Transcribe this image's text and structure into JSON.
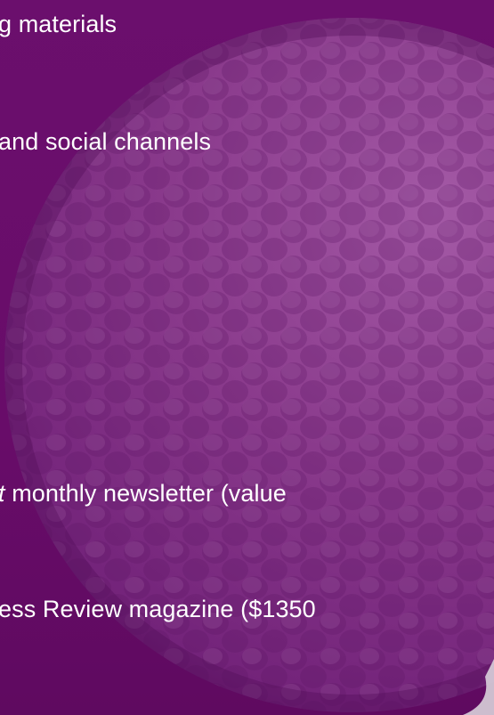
{
  "colors": {
    "background": "#6a0e6b",
    "ball": "#8e3c90",
    "text": "#ffffff"
  },
  "lines": [
    {
      "pre": "g materials",
      "em": "",
      "post": ""
    },
    {
      "pre": "and social channels",
      "em": "",
      "post": ""
    },
    {
      "pre": "",
      "em": "t",
      "post": " monthly newsletter (value"
    },
    {
      "pre": "ess Review magazine ($1350",
      "em": "",
      "post": ""
    }
  ],
  "decoration": {
    "icon": "golf-ball-icon"
  }
}
